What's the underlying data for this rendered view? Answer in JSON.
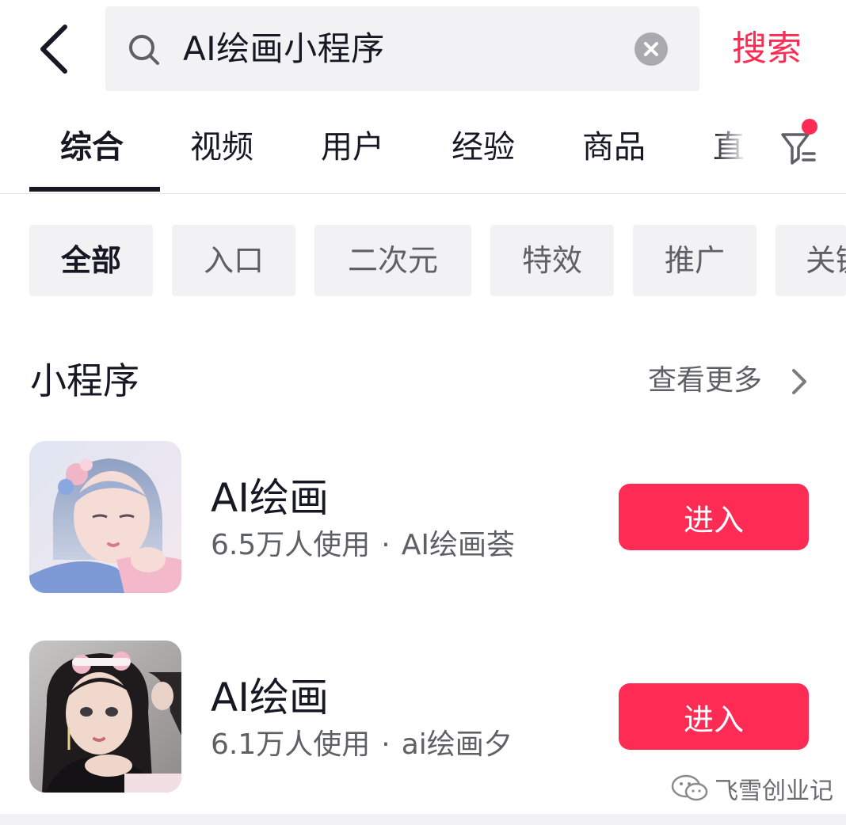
{
  "search": {
    "query": "AI绘画小程序",
    "button_label": "搜索"
  },
  "tabs": [
    {
      "label": "综合",
      "active": true
    },
    {
      "label": "视频"
    },
    {
      "label": "用户"
    },
    {
      "label": "经验"
    },
    {
      "label": "商品"
    },
    {
      "label": "直"
    }
  ],
  "chips": [
    {
      "label": "全部",
      "active": true
    },
    {
      "label": "入口"
    },
    {
      "label": "二次元"
    },
    {
      "label": "特效"
    },
    {
      "label": "推广"
    },
    {
      "label": "关键"
    }
  ],
  "section": {
    "title": "小程序",
    "see_more": "查看更多"
  },
  "results": [
    {
      "name": "AI绘画",
      "users": "6.5万人使用",
      "dot": "·",
      "author": "AI绘画荟",
      "button": "进入"
    },
    {
      "name": "AI绘画",
      "users": "6.1万人使用",
      "dot": "·",
      "author": "ai绘画夕",
      "button": "进入"
    }
  ],
  "watermark": "飞雪创业记",
  "colors": {
    "accent": "#fe2c55",
    "text_primary": "#161823",
    "text_secondary": "#5f5f66",
    "surface": "#f2f2f4"
  },
  "icons": [
    "back-icon",
    "search-icon",
    "clear-icon",
    "filter-icon",
    "chevron-right-icon",
    "wechat-icon"
  ]
}
